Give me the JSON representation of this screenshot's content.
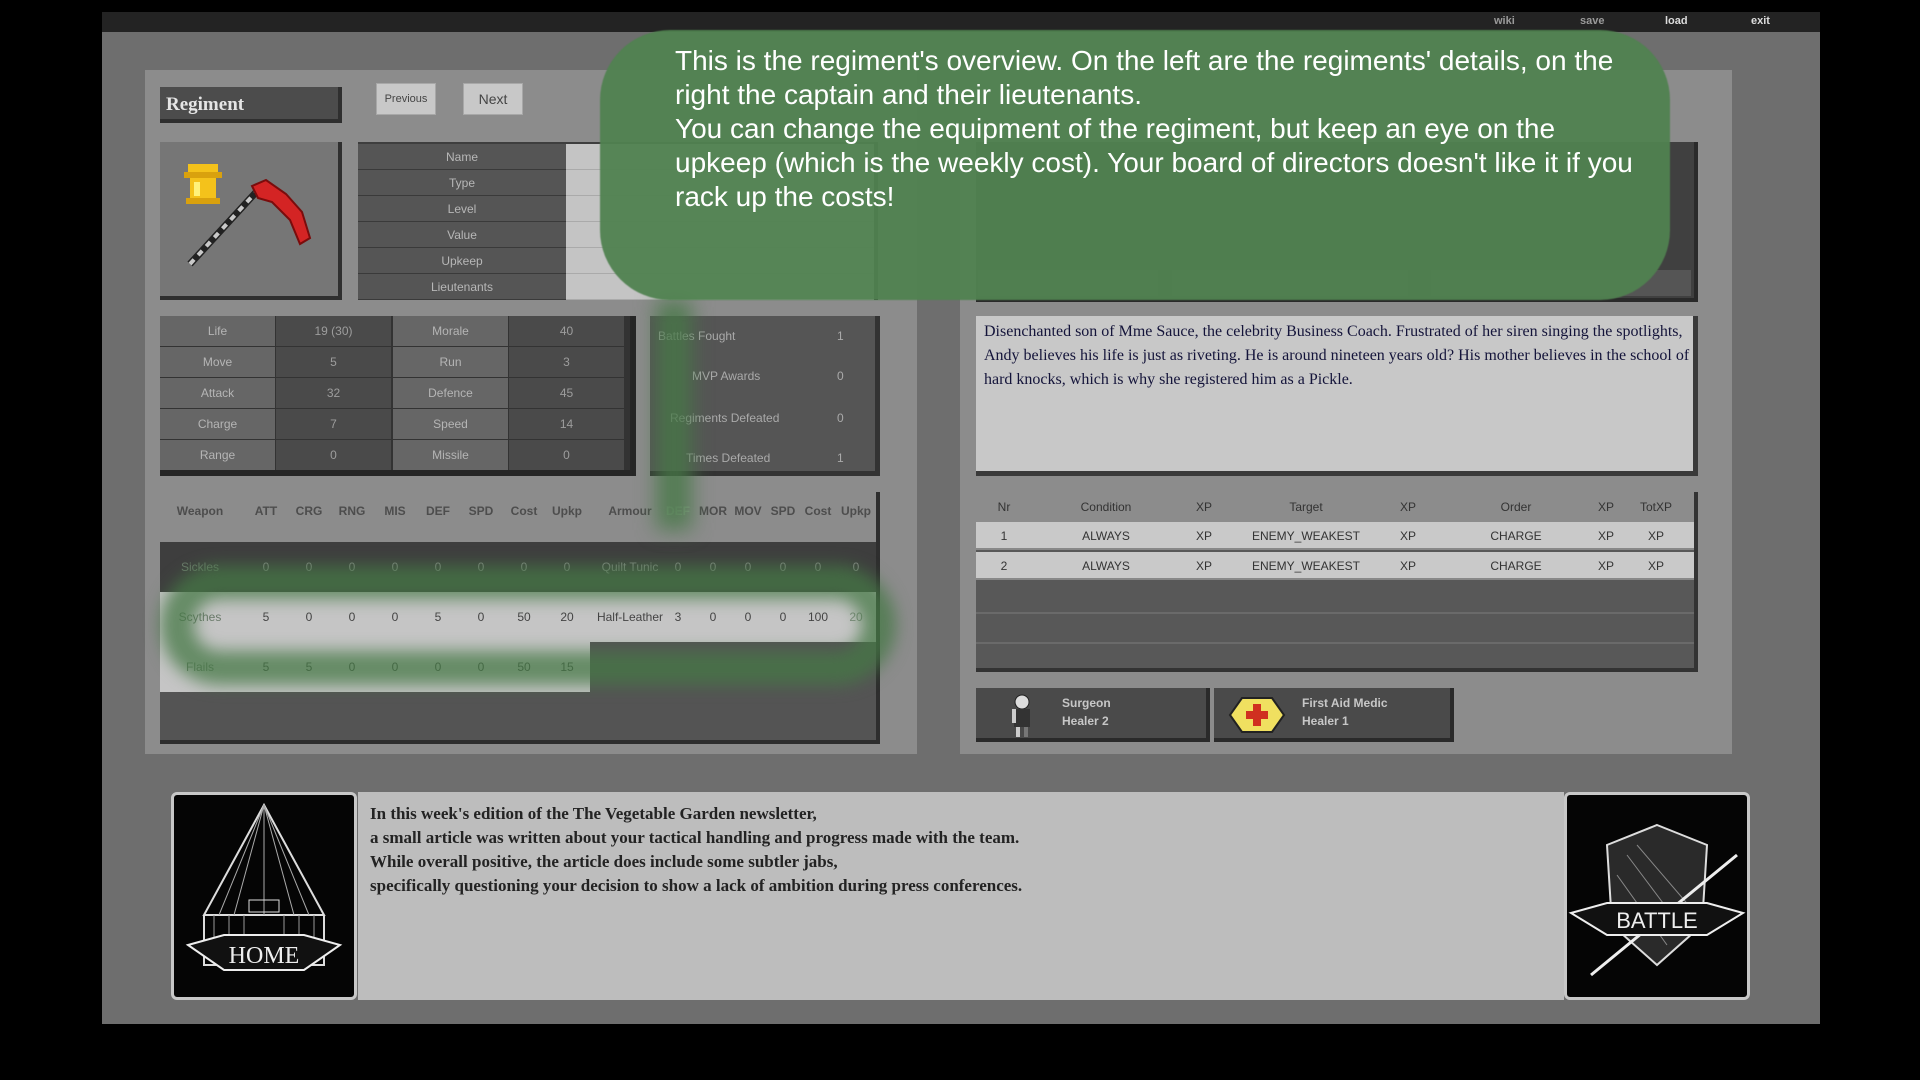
{
  "menu": {
    "wiki": "wiki",
    "save": "save",
    "load": "load",
    "exit": "exit"
  },
  "regiment": {
    "title": "Regiment",
    "previous": "Previous",
    "next": "Next",
    "info_labels": [
      "Name",
      "Type",
      "Level",
      "Value",
      "Upkeep",
      "Lieutenants"
    ]
  },
  "stats": [
    {
      "l1": "Life",
      "v1": "19 (30)",
      "l2": "Morale",
      "v2": "40"
    },
    {
      "l1": "Move",
      "v1": "5",
      "l2": "Run",
      "v2": "3"
    },
    {
      "l1": "Attack",
      "v1": "32",
      "l2": "Defence",
      "v2": "45"
    },
    {
      "l1": "Charge",
      "v1": "7",
      "l2": "Speed",
      "v2": "14"
    },
    {
      "l1": "Range",
      "v1": "0",
      "l2": "Missile",
      "v2": "0"
    }
  ],
  "record": [
    {
      "label": "Battles Fought",
      "value": "1"
    },
    {
      "label": "MVP Awards",
      "value": "0"
    },
    {
      "label": "Regiments Defeated",
      "value": "0"
    },
    {
      "label": "Times Defeated",
      "value": "1"
    }
  ],
  "weapons": {
    "headers": [
      "Weapon",
      "ATT",
      "CRG",
      "RNG",
      "MIS",
      "DEF",
      "SPD",
      "Cost",
      "Upkp",
      "Armour",
      "DEF",
      "MOR",
      "MOV",
      "SPD",
      "Cost",
      "Upkp"
    ],
    "rows": [
      [
        "Sickles",
        "0",
        "0",
        "0",
        "0",
        "0",
        "0",
        "0",
        "0",
        "Quilt Tunic",
        "0",
        "0",
        "0",
        "0",
        "0",
        "0"
      ],
      [
        "Scythes",
        "5",
        "0",
        "0",
        "0",
        "5",
        "0",
        "50",
        "20",
        "Half-Leather",
        "3",
        "0",
        "0",
        "0",
        "100",
        "20"
      ],
      [
        "Flails",
        "5",
        "5",
        "0",
        "0",
        "0",
        "0",
        "50",
        "15",
        "",
        "",
        "",
        "",
        "",
        "",
        ""
      ]
    ]
  },
  "captain": {
    "bio": "Disenchanted son of Mme Sauce, the celebrity Business Coach. Frustrated of her siren singing the spotlights, Andy believes his life is just as riveting. He is around nineteen years old? His mother believes in the school of hard knocks, which is why she registered him as a Pickle."
  },
  "orders": {
    "headers": [
      "Nr",
      "Condition",
      "XP",
      "Target",
      "XP",
      "Order",
      "XP",
      "TotXP"
    ],
    "rows": [
      [
        "1",
        "ALWAYS",
        "XP",
        "ENEMY_WEAKEST",
        "XP",
        "CHARGE",
        "XP",
        "XP"
      ],
      [
        "2",
        "ALWAYS",
        "XP",
        "ENEMY_WEAKEST",
        "XP",
        "CHARGE",
        "XP",
        "XP"
      ]
    ]
  },
  "lieutenants": [
    {
      "name": "Surgeon",
      "role": "Healer 2"
    },
    {
      "name": "First Aid Medic",
      "role": "Healer 1"
    }
  ],
  "news": [
    "In this week's edition of the The Vegetable Garden newsletter,",
    "a small article was written about your tactical handling and progress made with the team.",
    "While overall positive, the article does include some subtler jabs,",
    "specifically questioning your decision to show a lack of ambition during press conferences."
  ],
  "tiles": {
    "home": "HOME",
    "battle": "BATTLE"
  },
  "tutorial": {
    "line1": "This is the regiment's overview. On the left are the regiments' details, on the right the captain and their lieutenants.",
    "line2": "You can change the equipment of the regiment, but keep an eye on the upkeep (which is the weekly cost). Your board of directors doesn't like it if you rack up the costs!"
  },
  "colors": {
    "tutorial_bubble": "#508250",
    "panel": "#8c8c8c",
    "background": "#6e6e6e"
  }
}
